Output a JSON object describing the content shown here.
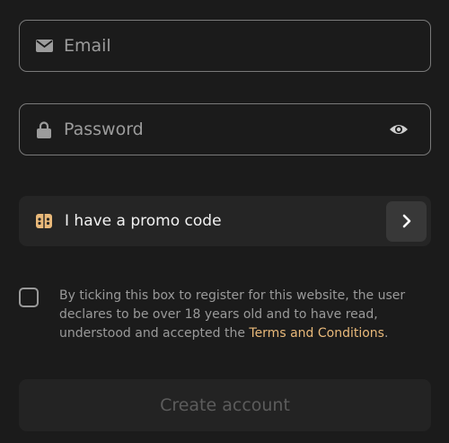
{
  "email": {
    "placeholder": "Email",
    "icon": "envelope-icon"
  },
  "password": {
    "placeholder": "Password",
    "icon": "lock-icon",
    "toggle_icon": "eye-icon"
  },
  "promo": {
    "label": "I have a promo code",
    "icon": "promo-coupon-icon",
    "arrow_icon": "chevron-right-icon"
  },
  "consent": {
    "text": "By ticking this box to register for this website, the user declares to be over 18 years old and to have read, understood and accepted the ",
    "link_text": "Terms and Conditions",
    "suffix": ".",
    "checked": false
  },
  "submit": {
    "label": "Create account"
  },
  "colors": {
    "accent": "#e9b97a",
    "background": "#1b1b1b",
    "border": "#7a7a7a"
  }
}
